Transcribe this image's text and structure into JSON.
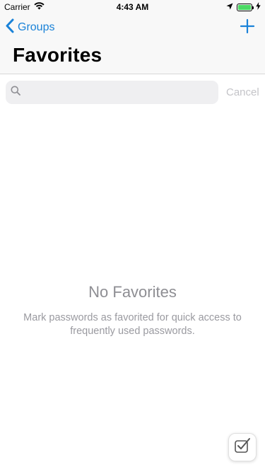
{
  "status_bar": {
    "carrier": "Carrier",
    "time": "4:43 AM",
    "battery_percent": 100,
    "battery_color": "#4cd964"
  },
  "nav": {
    "back_label": "Groups",
    "back_icon": "chevron-left-icon",
    "add_icon": "plus-icon",
    "title": "Favorites",
    "accent_color": "#1a82d8"
  },
  "search": {
    "placeholder": "",
    "value": "",
    "cancel_label": "Cancel"
  },
  "empty_state": {
    "title": "No Favorites",
    "message": "Mark passwords as favorited for quick access to frequently used passwords."
  }
}
